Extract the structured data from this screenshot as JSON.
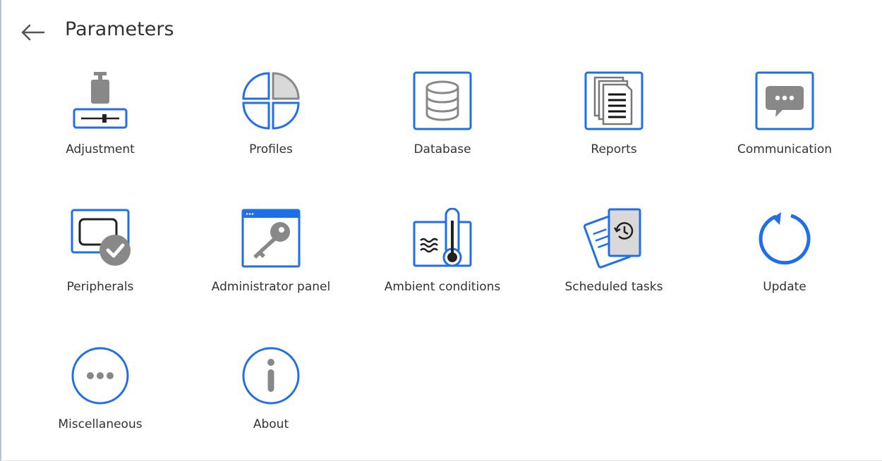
{
  "header": {
    "title": "Parameters",
    "back_icon": "arrow-left-icon"
  },
  "colors": {
    "accent": "#1f6fe8",
    "icon_gray": "#888888",
    "icon_light": "#d9d9d9",
    "text": "#333333"
  },
  "tiles": [
    {
      "label": "Adjustment",
      "icon": "weight-adjustment-icon"
    },
    {
      "label": "Profiles",
      "icon": "profiles-pie-icon"
    },
    {
      "label": "Database",
      "icon": "database-icon"
    },
    {
      "label": "Reports",
      "icon": "reports-icon"
    },
    {
      "label": "Communication",
      "icon": "chat-bubble-icon"
    },
    {
      "label": "Peripherals",
      "icon": "peripherals-icon"
    },
    {
      "label": "Administrator panel",
      "icon": "key-window-icon"
    },
    {
      "label": "Ambient conditions",
      "icon": "thermometer-icon"
    },
    {
      "label": "Scheduled tasks",
      "icon": "scheduled-tasks-icon"
    },
    {
      "label": "Update",
      "icon": "update-arrow-icon"
    },
    {
      "label": "Miscellaneous",
      "icon": "ellipsis-circle-icon"
    },
    {
      "label": "About",
      "icon": "info-circle-icon"
    }
  ]
}
